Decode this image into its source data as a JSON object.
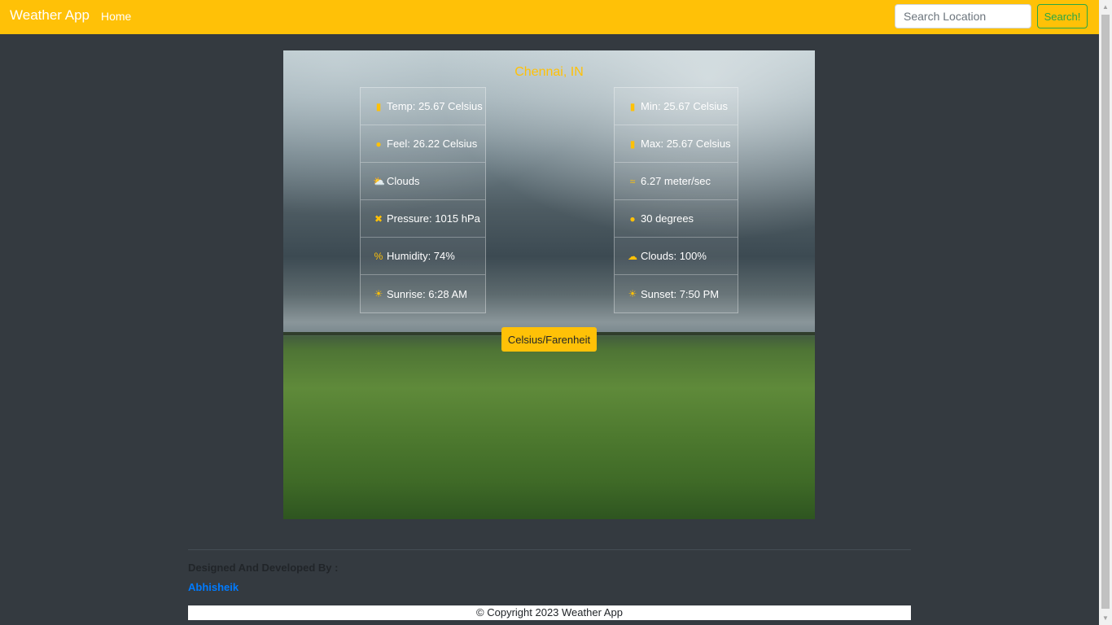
{
  "navbar": {
    "brand": "Weather App",
    "home_label": "Home",
    "search_placeholder": "Search Location",
    "search_button": "Search!"
  },
  "weather": {
    "city": "Chennai, IN",
    "left_stats": [
      {
        "icon": "thermometer-icon",
        "text": "Temp: 25.67 Celsius"
      },
      {
        "icon": "feels-like-icon",
        "text": "Feel: 26.22 Celsius"
      },
      {
        "icon": "cloud-sun-icon",
        "text": "Clouds"
      },
      {
        "icon": "pressure-icon",
        "text": "Pressure: 1015 hPa"
      },
      {
        "icon": "percent-icon",
        "text": "Humidity: 74%"
      },
      {
        "icon": "sunrise-icon",
        "text": "Sunrise: 6:28 AM"
      }
    ],
    "right_stats": [
      {
        "icon": "temp-min-icon",
        "text": "Min: 25.67 Celsius"
      },
      {
        "icon": "temp-max-icon",
        "text": "Max: 25.67 Celsius"
      },
      {
        "icon": "wind-icon",
        "text": "6.27 meter/sec"
      },
      {
        "icon": "compass-icon",
        "text": "30 degrees"
      },
      {
        "icon": "cloud-icon",
        "text": "Clouds: 100%"
      },
      {
        "icon": "sunset-icon",
        "text": "Sunset: 7:50 PM"
      }
    ],
    "unit_toggle": "Celsius/Farenheit"
  },
  "footer": {
    "credit": "Designed And Developed By :",
    "author": "Abhisheik",
    "copyright": "© Copyright 2023 Weather App"
  },
  "colors": {
    "accent": "#ffc107",
    "background": "#343a40",
    "link": "#007bff",
    "search_button": "#28a745"
  }
}
